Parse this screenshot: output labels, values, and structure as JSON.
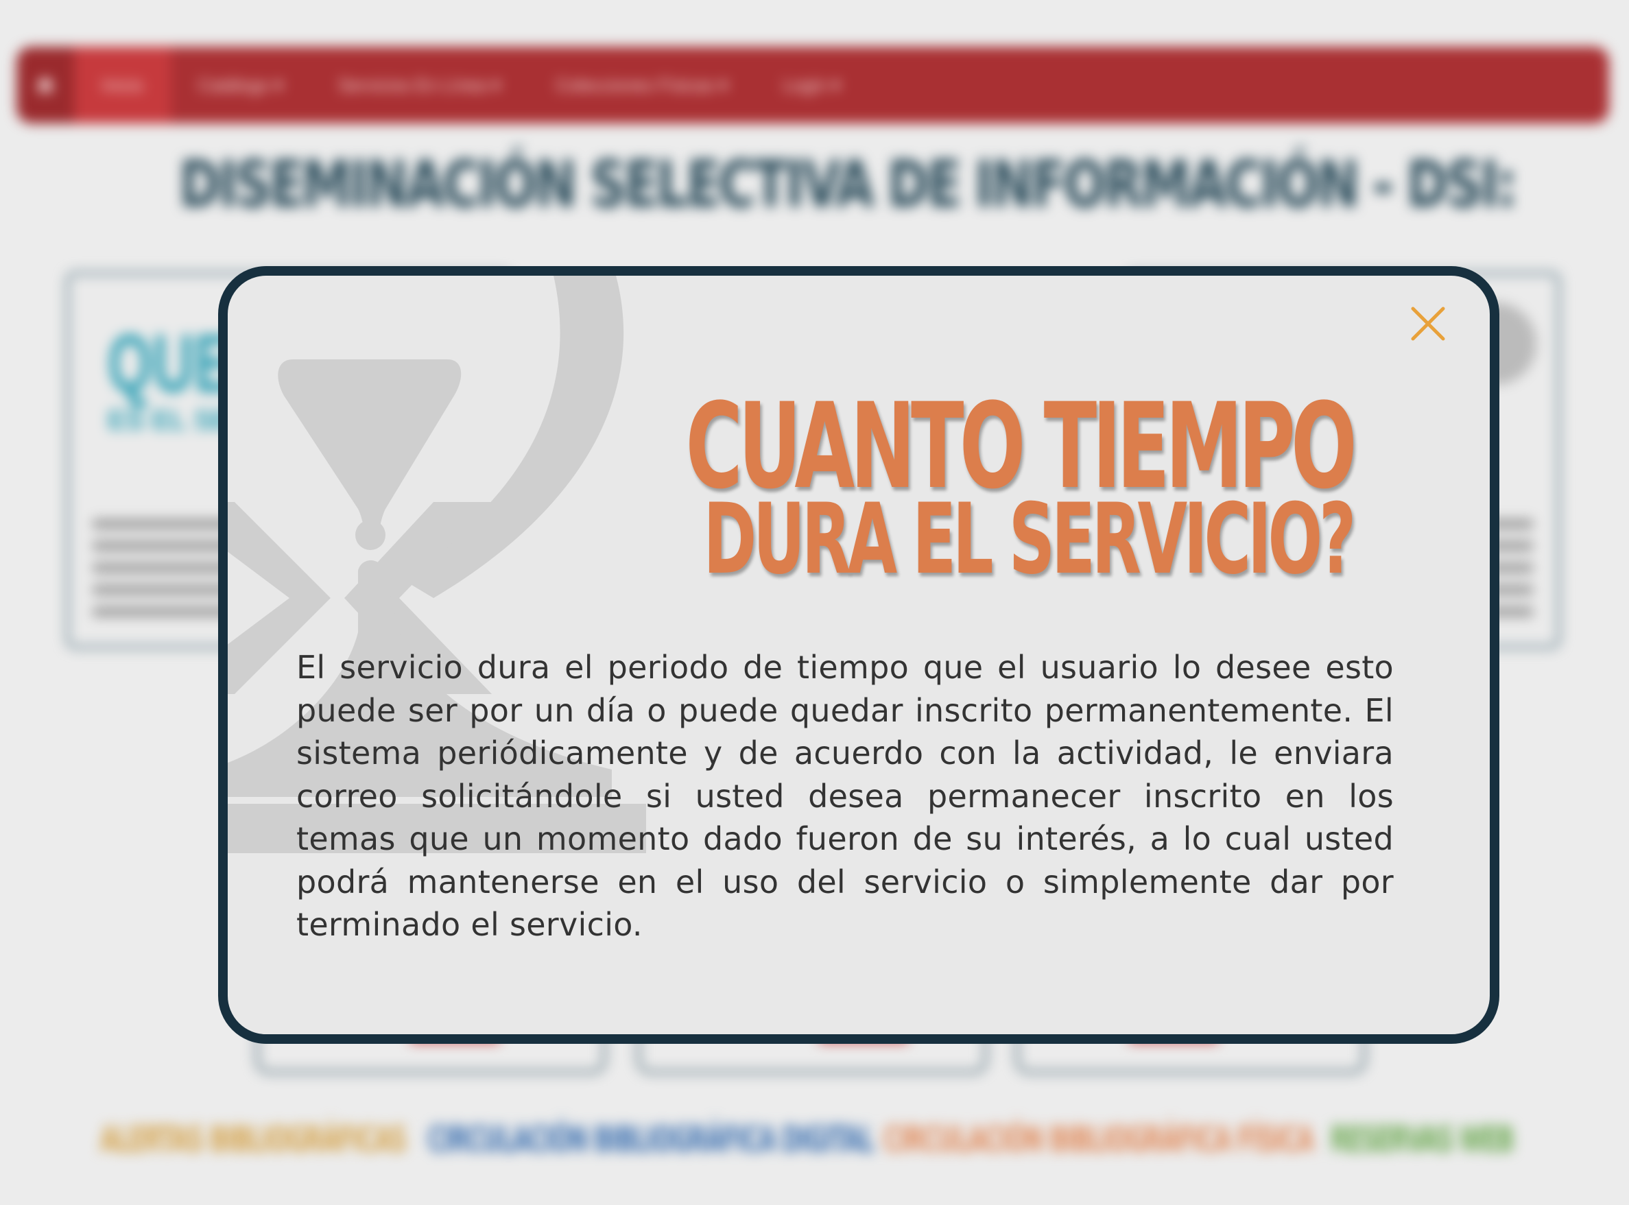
{
  "background": {
    "nav": {
      "items": [
        {
          "label": "Inicio"
        },
        {
          "label": "Catálogo ▾"
        },
        {
          "label": "Servicios En Línea ▾"
        },
        {
          "label": "Colecciones Físicas ▾"
        },
        {
          "label": "Login ▾"
        }
      ]
    },
    "page_title": "DISEMINACIÓN SELECTIVA DE INFORMACIÓN - DSI:",
    "left_card": {
      "heading": "QUE",
      "subheading": "ES EL SERV"
    },
    "bottom_links": [
      {
        "label": "ALERTAS BIBLIOGRÁFICAS",
        "color": "#d4a24a"
      },
      {
        "label": "CIRCULACIÓN BIBLIOGRÁFICA DIGITAL",
        "color": "#3a6fb0"
      },
      {
        "label": "CIRCULACIÓN BIBLIOGRÁFICA FÍSICA",
        "color": "#e08a5a"
      },
      {
        "label": "RESERVAS WEB",
        "color": "#6aa84f"
      }
    ]
  },
  "modal": {
    "close_icon": "close-icon",
    "close_color": "#e8a13a",
    "heading_line1": "CUANTO TIEMPO",
    "heading_line2": "DURA EL SERVICIO?",
    "heading_color": "#dc7e4c",
    "body": "El servicio dura el periodo de tiempo que el usuario lo desee esto puede ser por un día o puede quedar inscrito permanentemente. El sistema periódicamente y de acuerdo con la actividad, le enviara correo solicitándole si usted desea permanecer inscrito en los temas que un momento dado fueron de su interés, a lo cual usted podrá mantenerse en el uso del servicio o simplemente dar por terminado el servicio.",
    "decorative_icon": "hourglass-icon"
  }
}
